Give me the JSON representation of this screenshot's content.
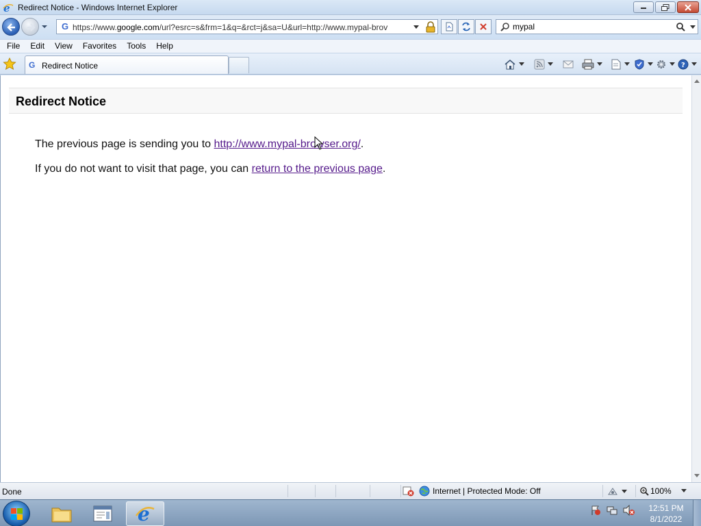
{
  "window": {
    "title": "Redirect Notice - Windows Internet Explorer"
  },
  "address": {
    "url_prefix": "https://www.",
    "url_host": "google.com",
    "url_rest": "/url?esrc=s&frm=1&q=&rct=j&sa=U&url=http://www.mypal-brov"
  },
  "search": {
    "value": "mypal"
  },
  "menu": {
    "items": [
      "File",
      "Edit",
      "View",
      "Favorites",
      "Tools",
      "Help"
    ]
  },
  "tabs": {
    "active_label": "Redirect Notice"
  },
  "page": {
    "heading": "Redirect Notice",
    "line1_text": "The previous page is sending you to ",
    "line1_link": "http://www.mypal-browser.org/",
    "line1_end": ".",
    "line2_text": "If you do not want to visit that page, you can ",
    "line2_link": "return to the previous page",
    "line2_end": "."
  },
  "status": {
    "text": "Done",
    "zone": "Internet | Protected Mode: Off",
    "zoom": "100%"
  },
  "taskbar": {
    "time": "12:51 PM",
    "date": "8/1/2022"
  },
  "colors": {
    "link": "#551a8b",
    "chrome": "#cfe0f3"
  }
}
